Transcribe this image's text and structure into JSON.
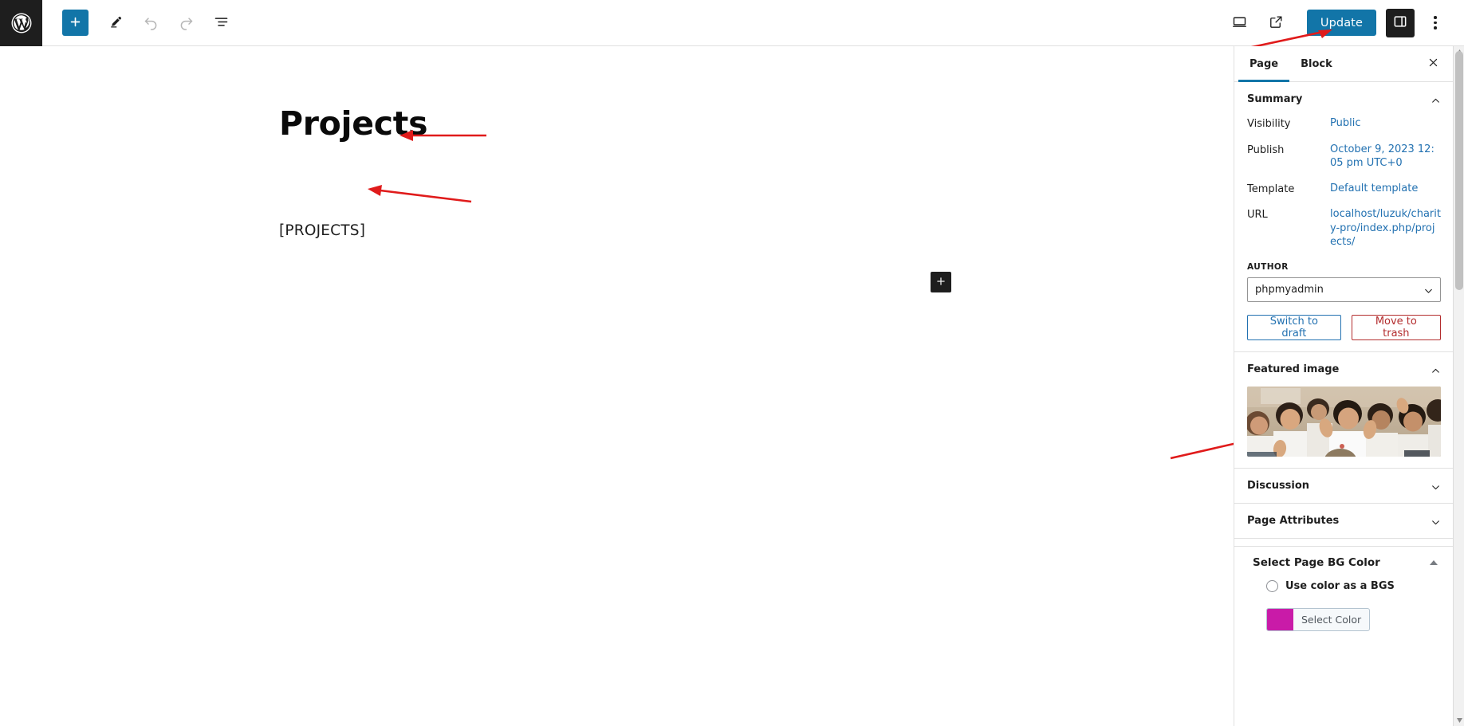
{
  "toolbar": {
    "logo_icon": "wordpress-logo-icon",
    "add_block_label": "+",
    "add_block_icon": "plus-icon",
    "tools_icon": "pencil-edit-icon",
    "undo_icon": "undo-arrow-icon",
    "redo_icon": "redo-arrow-icon",
    "list_view_icon": "list-view-icon",
    "view_icon": "desktop-preview-icon",
    "preview_icon": "external-link-icon",
    "update_label": "Update",
    "settings_icon": "settings-sidebar-icon",
    "options_icon": "kebab-menu-icon"
  },
  "canvas": {
    "post_title": "Projects",
    "shortcode_block": "[PROJECTS]",
    "inserter_icon": "plus-icon"
  },
  "sidebar": {
    "tabs": [
      {
        "label": "Page",
        "active": true
      },
      {
        "label": "Block",
        "active": false
      }
    ],
    "close_icon": "close-x-icon",
    "summary": {
      "title": "Summary",
      "collapse_icon": "chevron-up-icon",
      "rows": [
        {
          "label": "Visibility",
          "value": "Public"
        },
        {
          "label": "Publish",
          "value": "October 9, 2023 12:05 pm UTC+0"
        },
        {
          "label": "Template",
          "value": "Default template"
        },
        {
          "label": "URL",
          "value": "localhost/luzuk/charity-pro/index.php/projects/"
        }
      ],
      "author_label": "AUTHOR",
      "author_value": "phpmyadmin",
      "author_chevron_icon": "chevron-down-icon",
      "switch_to_draft_label": "Switch to draft",
      "move_to_trash_label": "Move to trash"
    },
    "featured_image": {
      "title": "Featured image",
      "collapse_icon": "chevron-up-icon",
      "alt": "group of smiling children in white school shirts waving at camera"
    },
    "discussion": {
      "title": "Discussion",
      "expand_icon": "chevron-down-icon"
    },
    "page_attributes": {
      "title": "Page Attributes",
      "expand_icon": "chevron-down-icon"
    },
    "bg_color_metabox": {
      "title": "Select Page BG Color",
      "toggle_icon": "triangle-up-icon",
      "checkbox_label": "Use color as a BGS",
      "checkbox_icon": "radio-circle-icon",
      "select_color_label": "Select Color",
      "swatch_color": "#c91ba8"
    }
  },
  "annotations": {
    "color": "#e01b1b",
    "arrows": [
      {
        "name": "arrow-to-update-button"
      },
      {
        "name": "arrow-to-post-title"
      },
      {
        "name": "arrow-to-shortcode-block"
      },
      {
        "name": "arrow-to-featured-image"
      }
    ]
  },
  "theme": {
    "accent": "#1275a8",
    "link": "#2271b1",
    "danger": "#b32d2e",
    "dark": "#1e1e1e"
  }
}
